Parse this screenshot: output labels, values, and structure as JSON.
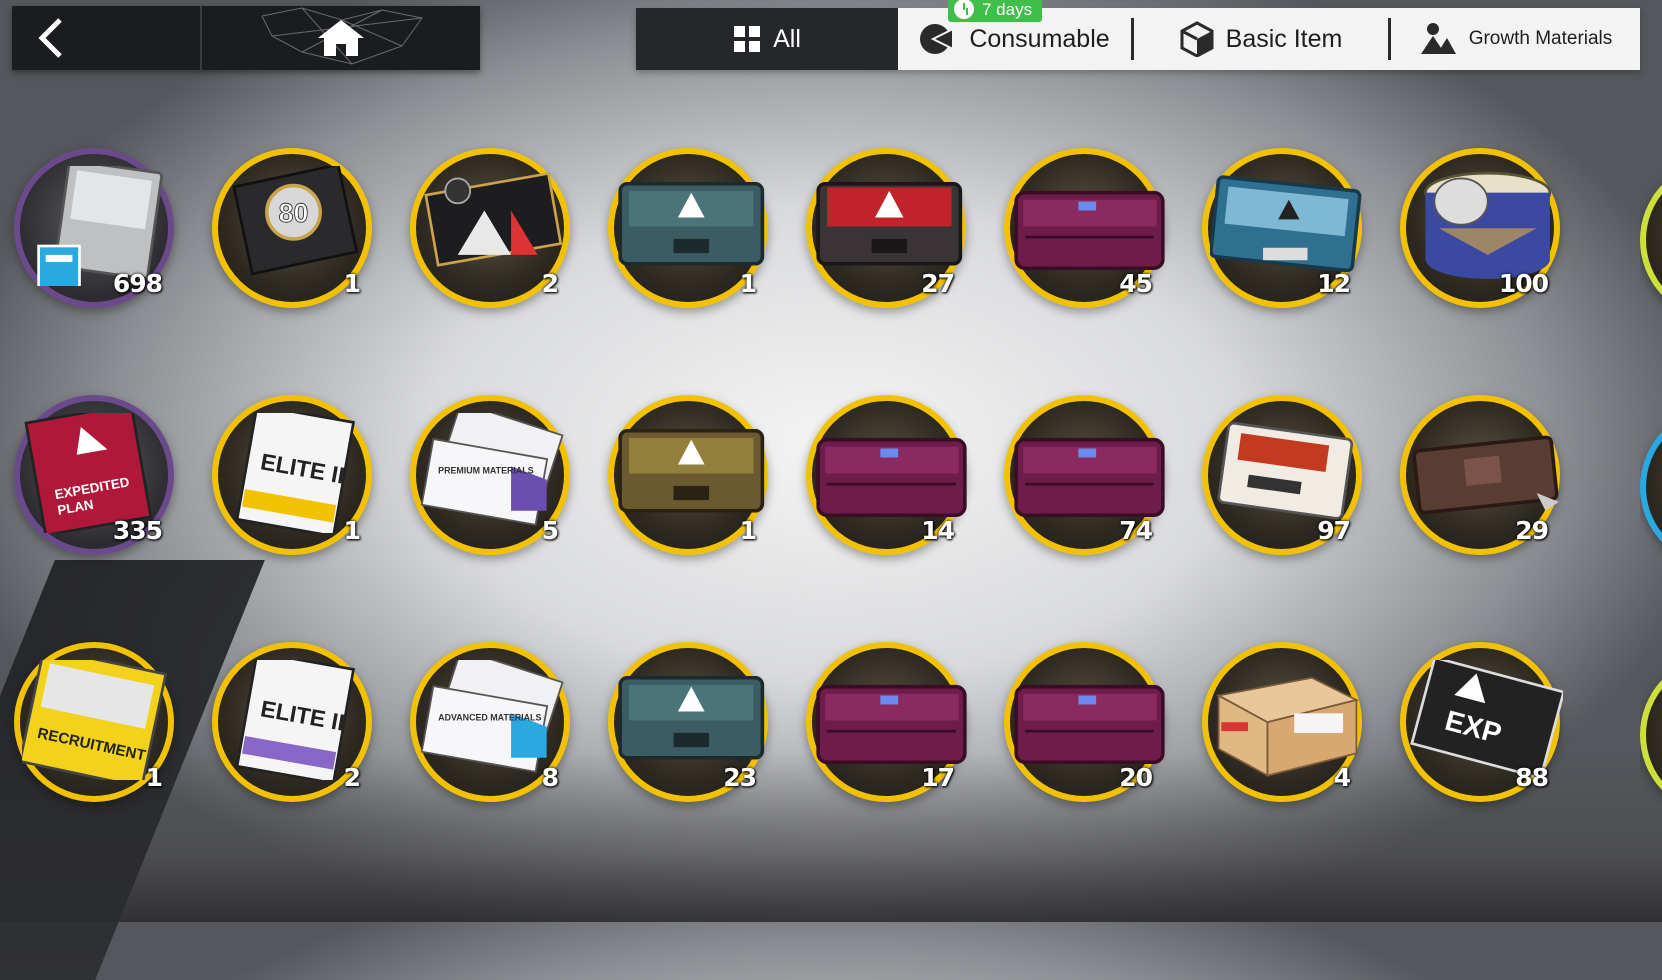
{
  "nav": {
    "back_icon": "chevron-left-icon",
    "home_icon": "home-icon"
  },
  "tabs": [
    {
      "label": "All",
      "icon": "grid-icon",
      "active": true
    },
    {
      "label": "Consumable",
      "icon": "consumable-icon",
      "badge": "7 days"
    },
    {
      "label": "Basic Item",
      "icon": "cube-icon"
    },
    {
      "label": "Growth Materials",
      "icon": "growth-icon"
    }
  ],
  "items": [
    {
      "name": "silver-pouch",
      "count": "698",
      "ring": "purple",
      "art": "pouch"
    },
    {
      "name": "level-80-box",
      "count": "1",
      "ring": "gold",
      "art": "box80"
    },
    {
      "name": "star-box",
      "count": "2",
      "ring": "gold",
      "art": "starbox"
    },
    {
      "name": "teal-crate",
      "count": "1",
      "ring": "gold",
      "art": "tealcrate"
    },
    {
      "name": "red-crate",
      "count": "27",
      "ring": "gold",
      "art": "redcrate"
    },
    {
      "name": "purple-case-a",
      "count": "45",
      "ring": "gold",
      "art": "purplecase"
    },
    {
      "name": "blue-case",
      "count": "12",
      "ring": "gold",
      "art": "bluecase"
    },
    {
      "name": "drum-mask",
      "count": "100",
      "ring": "gold",
      "art": "drum"
    },
    {
      "name": "expedited-plan",
      "count": "335",
      "ring": "purple",
      "art": "plan"
    },
    {
      "name": "elite-manual-yellow",
      "count": "1",
      "ring": "gold",
      "art": "eliteyellow"
    },
    {
      "name": "premium-material",
      "count": "5",
      "ring": "gold",
      "art": "premium"
    },
    {
      "name": "orange-crate",
      "count": "1",
      "ring": "gold",
      "art": "orangecrate"
    },
    {
      "name": "purple-case-b",
      "count": "14",
      "ring": "gold",
      "art": "purplecase"
    },
    {
      "name": "purple-case-c",
      "count": "74",
      "ring": "gold",
      "art": "purplecase"
    },
    {
      "name": "white-device",
      "count": "97",
      "ring": "gold",
      "art": "device"
    },
    {
      "name": "brown-briefcase",
      "count": "29",
      "ring": "gold",
      "art": "briefcase"
    },
    {
      "name": "recruitment-pack",
      "count": "1",
      "ring": "gold",
      "art": "recruit"
    },
    {
      "name": "elite-manual-purple",
      "count": "2",
      "ring": "gold",
      "art": "elitepurple"
    },
    {
      "name": "advanced-material",
      "count": "8",
      "ring": "gold",
      "art": "advanced"
    },
    {
      "name": "teal-crate-b",
      "count": "23",
      "ring": "gold",
      "art": "tealcrate"
    },
    {
      "name": "purple-case-d",
      "count": "17",
      "ring": "gold",
      "art": "purplecase"
    },
    {
      "name": "purple-case-e",
      "count": "20",
      "ring": "gold",
      "art": "purplecase"
    },
    {
      "name": "cardboard-box",
      "count": "4",
      "ring": "gold",
      "art": "cardboard"
    },
    {
      "name": "exp-card",
      "count": "88",
      "ring": "gold",
      "art": "exp"
    }
  ],
  "colors": {
    "ring_gold": "#f2c200",
    "tab_active": "#26272b",
    "badge_green": "#3fbf4a"
  }
}
